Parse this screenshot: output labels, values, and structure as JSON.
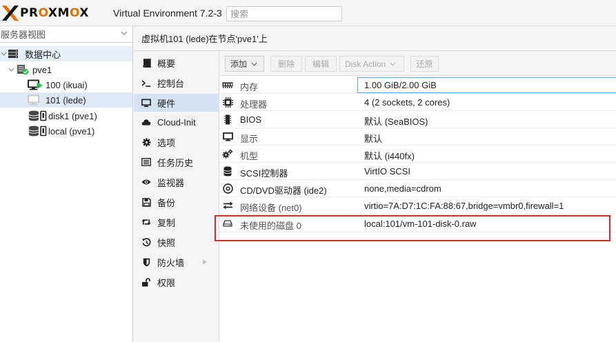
{
  "header": {
    "logo_text": "PROXMOX",
    "product_title": "Virtual Environment 7.2-3",
    "search_placeholder": "搜索",
    "accent_color": "#e57000"
  },
  "left": {
    "view_select": "服务器视图",
    "tree": [
      {
        "label": "数据中心",
        "icon": "datacenter-icon"
      },
      {
        "label": "pve1",
        "icon": "node-online-icon"
      },
      {
        "label": "100 (ikuai)",
        "icon": "vm-running-icon"
      },
      {
        "label": "101 (lede)",
        "icon": "vm-stopped-icon"
      },
      {
        "label": "disk1 (pve1)",
        "icon": "storage-icon"
      },
      {
        "label": "local (pve1)",
        "icon": "storage-icon"
      }
    ]
  },
  "main": {
    "title": "虚拟机101 (lede)在节点'pve1'上"
  },
  "nav": [
    {
      "label": "概要",
      "icon": "book-icon"
    },
    {
      "label": "控制台",
      "icon": "terminal-icon"
    },
    {
      "label": "硬件",
      "icon": "desktop-icon"
    },
    {
      "label": "Cloud-Init",
      "icon": "cloud-icon"
    },
    {
      "label": "选项",
      "icon": "gear-icon"
    },
    {
      "label": "任务历史",
      "icon": "list-icon"
    },
    {
      "label": "监视器",
      "icon": "eye-icon"
    },
    {
      "label": "备份",
      "icon": "floppy-icon"
    },
    {
      "label": "复制",
      "icon": "retweet-icon"
    },
    {
      "label": "快照",
      "icon": "history-icon"
    },
    {
      "label": "防火墙",
      "icon": "shield-icon"
    },
    {
      "label": "权限",
      "icon": "unlock-icon"
    }
  ],
  "toolbar": {
    "add": "添加",
    "remove": "删除",
    "edit": "编辑",
    "disk_action": "Disk Action",
    "revert": "还原"
  },
  "hardware": [
    {
      "label": "内存",
      "value": "1.00 GiB/2.00 GiB",
      "icon": "memory-icon"
    },
    {
      "label": "处理器",
      "value": "4 (2 sockets, 2 cores)",
      "icon": "cpu-icon"
    },
    {
      "label": "BIOS",
      "value": "默认 (SeaBIOS)",
      "icon": "microchip-icon"
    },
    {
      "label": "显示",
      "value": "默认",
      "icon": "display-icon"
    },
    {
      "label": "机型",
      "value": "默认 (i440fx)",
      "icon": "cogs-icon"
    },
    {
      "label": "SCSI控制器",
      "value": "VirtIO SCSI",
      "icon": "database-icon"
    },
    {
      "label": "CD/DVD驱动器 (ide2)",
      "value": "none,media=cdrom",
      "icon": "cdrom-icon"
    },
    {
      "label": "网络设备 (net0)",
      "value": "virtio=7A:D7:1C:FA:88:67,bridge=vmbr0,firewall=1",
      "icon": "exchange-icon"
    },
    {
      "label": "未使用的磁盘 0",
      "value": "local:101/vm-101-disk-0.raw",
      "icon": "hdd-icon"
    }
  ]
}
